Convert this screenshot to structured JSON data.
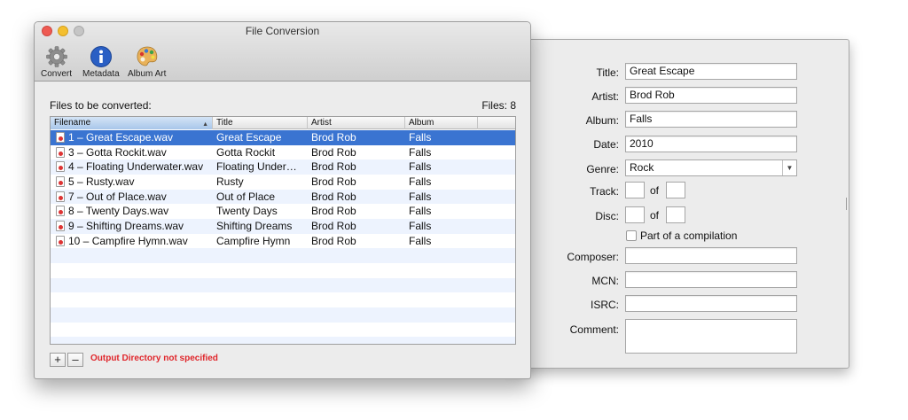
{
  "window": {
    "title": "File Conversion"
  },
  "toolbar": {
    "convert": {
      "label": "Convert",
      "icon": "gear-icon"
    },
    "metadata": {
      "label": "Metadata",
      "icon": "info-icon"
    },
    "album_art": {
      "label": "Album Art",
      "icon": "palette-icon"
    }
  },
  "files_label": "Files to be converted:",
  "files_count": "Files: 8",
  "table": {
    "columns": [
      "Filename",
      "Title",
      "Artist",
      "Album"
    ],
    "rows": [
      {
        "filename": "1 – Great Escape.wav",
        "title": "Great Escape",
        "artist": "Brod Rob",
        "album": "Falls"
      },
      {
        "filename": "3 – Gotta Rockit.wav",
        "title": "Gotta Rockit",
        "artist": "Brod Rob",
        "album": "Falls"
      },
      {
        "filename": "4 – Floating Underwater.wav",
        "title": "Floating Under…",
        "artist": "Brod Rob",
        "album": "Falls"
      },
      {
        "filename": "5 – Rusty.wav",
        "title": "Rusty",
        "artist": "Brod Rob",
        "album": "Falls"
      },
      {
        "filename": "7 – Out of Place.wav",
        "title": "Out of Place",
        "artist": "Brod Rob",
        "album": "Falls"
      },
      {
        "filename": "8 – Twenty Days.wav",
        "title": "Twenty Days",
        "artist": "Brod Rob",
        "album": "Falls"
      },
      {
        "filename": "9 – Shifting Dreams.wav",
        "title": "Shifting Dreams",
        "artist": "Brod Rob",
        "album": "Falls"
      },
      {
        "filename": "10 – Campfire Hymn.wav",
        "title": "Campfire Hymn",
        "artist": "Brod Rob",
        "album": "Falls"
      }
    ]
  },
  "bottom": {
    "add_label": "+",
    "remove_label": "–",
    "output_status": "Output Directory not specified"
  },
  "metadata": {
    "title_label": "Title:",
    "title_value": "Great Escape",
    "artist_label": "Artist:",
    "artist_value": "Brod Rob",
    "album_label": "Album:",
    "album_value": "Falls",
    "date_label": "Date:",
    "date_value": "2010",
    "genre_label": "Genre:",
    "genre_value": "Rock",
    "track_label": "Track:",
    "track_of": "of",
    "disc_label": "Disc:",
    "disc_of": "of",
    "compilation_label": "Part of a compilation",
    "composer_label": "Composer:",
    "mcn_label": "MCN:",
    "isrc_label": "ISRC:",
    "comment_label": "Comment:"
  },
  "colors": {
    "selection": "#3a74d1",
    "alt_row": "#edf3fe",
    "error_text": "#e0262b"
  }
}
